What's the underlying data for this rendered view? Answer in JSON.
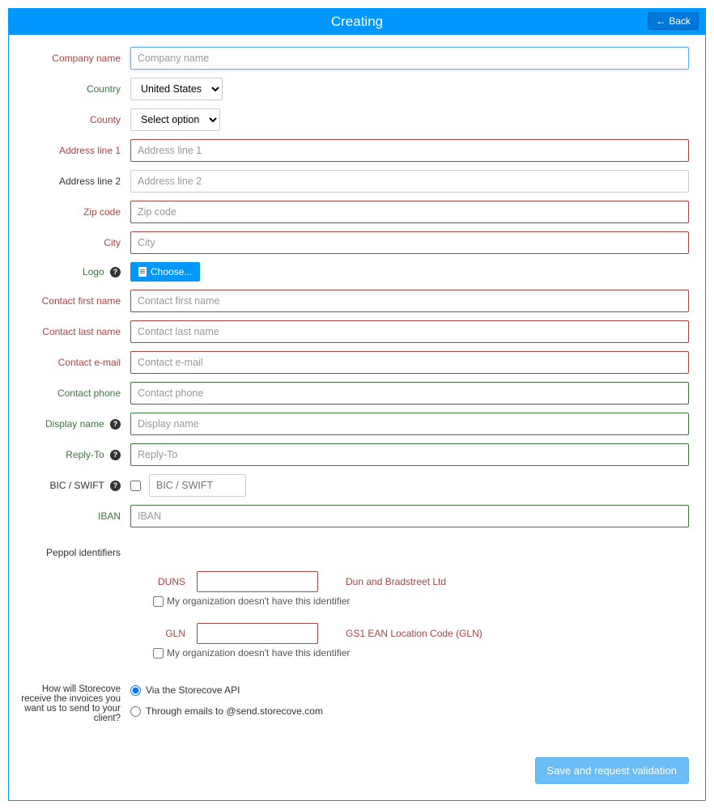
{
  "header": {
    "title": "Creating",
    "back_label": "Back"
  },
  "labels": {
    "company_name": "Company name",
    "country": "Country",
    "county": "County",
    "address1": "Address line 1",
    "address2": "Address line 2",
    "zip": "Zip code",
    "city": "City",
    "logo": "Logo",
    "contact_first": "Contact first name",
    "contact_last": "Contact last name",
    "contact_email": "Contact e-mail",
    "contact_phone": "Contact phone",
    "display_name": "Display name",
    "reply_to": "Reply-To",
    "bic": "BIC / SWIFT",
    "iban": "IBAN",
    "peppol": "Peppol identifiers",
    "delivery": "How will Storecove receive the invoices you want us to send to your client?"
  },
  "placeholders": {
    "company_name": "Company name",
    "address1": "Address line 1",
    "address2": "Address line 2",
    "zip": "Zip code",
    "city": "City",
    "contact_first": "Contact first name",
    "contact_last": "Contact last name",
    "contact_email": "Contact e-mail",
    "contact_phone": "Contact phone",
    "display_name": "Display name",
    "reply_to": "Reply-To",
    "bic": "BIC / SWIFT",
    "iban": "IBAN"
  },
  "values": {
    "country": "United States",
    "county": "Select option"
  },
  "logo_button": "Choose...",
  "peppol": {
    "duns": {
      "name": "DUNS",
      "desc": "Dun and Bradstreet Ltd"
    },
    "gln": {
      "name": "GLN",
      "desc": "GS1 EAN Location Code (GLN)"
    },
    "no_id_text": "My organization doesn't have this identifier"
  },
  "delivery_options": {
    "api": "Via the Storecove API",
    "email": "Through emails to @send.storecove.com"
  },
  "footer": {
    "save": "Save and request validation"
  }
}
